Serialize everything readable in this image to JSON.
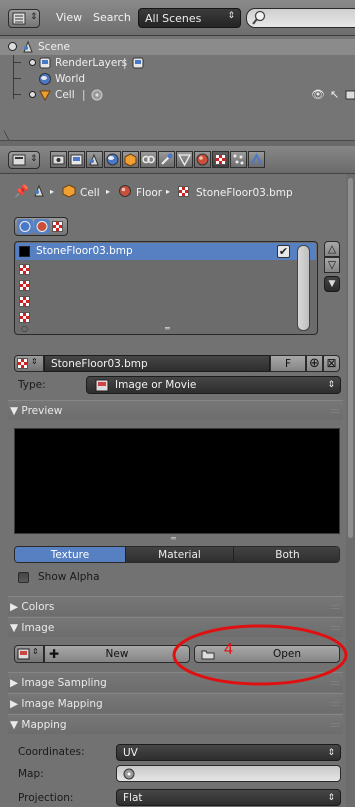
{
  "outliner": {
    "header": {
      "view_menu": "View",
      "search_menu": "Search",
      "display_mode": "All Scenes",
      "search_placeholder": ""
    },
    "tree": [
      {
        "label": "Scene",
        "icon": "scene-icon"
      },
      {
        "label": "RenderLayers",
        "icon": "render-layers-icon"
      },
      {
        "label": "World",
        "icon": "world-icon"
      },
      {
        "label": "Cell",
        "icon": "object-icon"
      }
    ]
  },
  "properties": {
    "breadcrumb": [
      "Cell",
      "Floor",
      "StoneFloor03.bmp"
    ],
    "texture_slots": [
      {
        "name": "StoneFloor03.bmp",
        "enabled": true
      },
      {
        "name": "",
        "enabled": false
      },
      {
        "name": "",
        "enabled": false
      },
      {
        "name": "",
        "enabled": false
      },
      {
        "name": "",
        "enabled": false
      }
    ],
    "texture_name": "StoneFloor03.bmp",
    "fake_user": "F",
    "type_label": "Type:",
    "type_value": "Image or Movie",
    "panels": {
      "preview": "Preview",
      "colors": "Colors",
      "image": "Image",
      "image_sampling": "Image Sampling",
      "image_mapping": "Image Mapping",
      "mapping": "Mapping"
    },
    "preview_tabs": [
      "Texture",
      "Material",
      "Both"
    ],
    "preview_active_tab": "Texture",
    "show_alpha": "Show Alpha",
    "image_new": "New",
    "image_open": "Open",
    "mapping": {
      "coordinates_label": "Coordinates:",
      "coordinates_value": "UV",
      "map_label": "Map:",
      "projection_label": "Projection:",
      "projection_value": "Flat"
    }
  },
  "annotation": {
    "number": "4",
    "color": "#e01010"
  },
  "colors": {
    "selection_blue": "#5680c2",
    "active_tab": "#5680c2"
  }
}
